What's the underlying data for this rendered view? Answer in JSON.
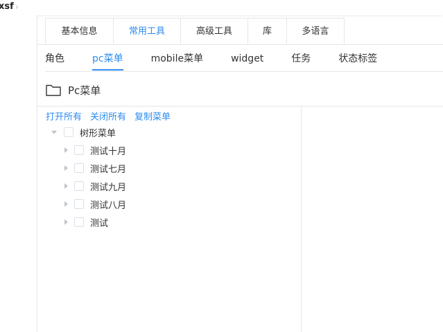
{
  "breadcrumb": {
    "current": "xsf"
  },
  "tabs": [
    {
      "label": "基本信息",
      "active": false
    },
    {
      "label": "常用工具",
      "active": true
    },
    {
      "label": "高级工具",
      "active": false
    },
    {
      "label": "库",
      "active": false
    },
    {
      "label": "多语言",
      "active": false
    }
  ],
  "subtabs": [
    {
      "label": "角色",
      "active": false
    },
    {
      "label": "pc菜单",
      "active": true
    },
    {
      "label": "mobile菜单",
      "active": false
    },
    {
      "label": "widget",
      "active": false
    },
    {
      "label": "任务",
      "active": false
    },
    {
      "label": "状态标签",
      "active": false
    }
  ],
  "section": {
    "title": "Pc菜单",
    "icon": "folder-icon"
  },
  "actions": {
    "expand_all": "打开所有",
    "collapse_all": "关闭所有",
    "copy_menu": "复制菜单"
  },
  "tree": {
    "root": {
      "label": "树形菜单",
      "expanded": true,
      "checked": false
    },
    "children": [
      {
        "label": "测试十月",
        "expanded": false,
        "checked": false
      },
      {
        "label": "测试七月",
        "expanded": false,
        "checked": false
      },
      {
        "label": "测试九月",
        "expanded": false,
        "checked": false
      },
      {
        "label": "测试八月",
        "expanded": false,
        "checked": false
      },
      {
        "label": "测试",
        "expanded": false,
        "checked": false
      }
    ]
  },
  "colors": {
    "accent": "#2d8cf0",
    "border": "#e6e6e6",
    "caret": "#c0c4cc"
  }
}
